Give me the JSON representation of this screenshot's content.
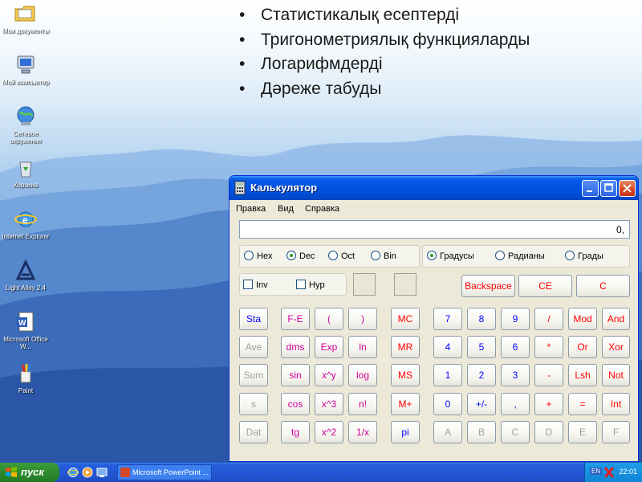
{
  "desktop": {
    "icons": [
      {
        "label": "Мои документы"
      },
      {
        "label": "Мой компьютер"
      },
      {
        "label": "Сетевое окружение"
      },
      {
        "label": "Корзина"
      },
      {
        "label": "Internet Explorer"
      },
      {
        "label": "Light Alloy 2.4"
      },
      {
        "label": "Microsoft Office W..."
      },
      {
        "label": "Paint"
      }
    ]
  },
  "slide": {
    "bullets": [
      "Статистикалық есептерді",
      "Тригонометриялық функцияларды",
      "Логарифмдерді",
      "Дәреже табуды"
    ]
  },
  "calculator": {
    "title": "Калькулятор",
    "menu": [
      "Правка",
      "Вид",
      "Справка"
    ],
    "display": "0,",
    "base_options": [
      "Hex",
      "Dec",
      "Oct",
      "Bin"
    ],
    "base_selected": "Dec",
    "angle_options": [
      "Градусы",
      "Радианы",
      "Грады"
    ],
    "angle_selected": "Градусы",
    "checks": [
      "Inv",
      "Hyp"
    ],
    "edit_keys": [
      "Backspace",
      "CE",
      "C"
    ],
    "stat_keys": [
      "Sta",
      "Ave",
      "Sum",
      "s",
      "Dat"
    ],
    "sci_keys": [
      [
        "F-E",
        "(",
        ")"
      ],
      [
        "dms",
        "Exp",
        "ln"
      ],
      [
        "sin",
        "x^y",
        "log"
      ],
      [
        "cos",
        "x^3",
        "n!"
      ],
      [
        "tg",
        "x^2",
        "1/x"
      ]
    ],
    "mem_keys": [
      "MC",
      "MR",
      "MS",
      "M+",
      "pi"
    ],
    "num_keys": [
      [
        "7",
        "8",
        "9",
        "/",
        "Mod",
        "And"
      ],
      [
        "4",
        "5",
        "6",
        "*",
        "Or",
        "Xor"
      ],
      [
        "1",
        "2",
        "3",
        "-",
        "Lsh",
        "Not"
      ],
      [
        "0",
        "+/-",
        ",",
        "+",
        "=",
        "Int"
      ],
      [
        "A",
        "B",
        "C",
        "D",
        "E",
        "F"
      ]
    ]
  },
  "taskbar": {
    "start_label": "пуск",
    "task_label": "Microsoft PowerPoint ...",
    "tray_lang": "EN",
    "clock": "22:01"
  },
  "colors": {
    "titlebar": "#0054e3",
    "window_bg": "#ece9d8",
    "key_blue": "#0000ff",
    "key_red": "#ff0000",
    "key_magenta": "#d0009a",
    "start_green": "#2c8a2c"
  }
}
